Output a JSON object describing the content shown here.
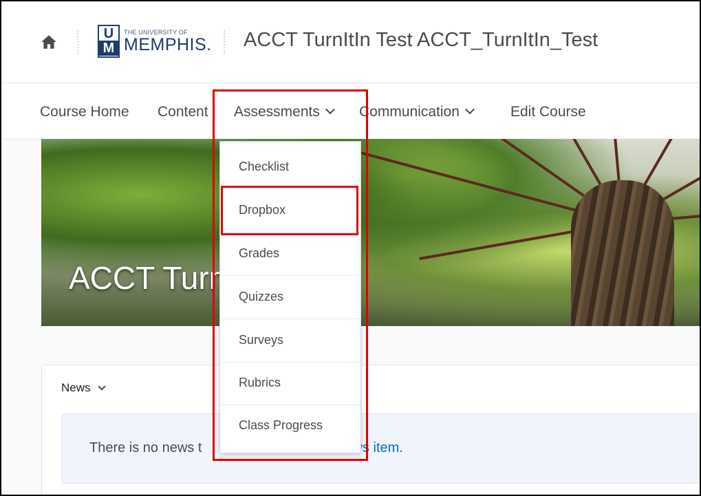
{
  "header": {
    "home_icon": "home-icon",
    "logo": {
      "small_text": "THE UNIVERSITY OF",
      "big_text": "MEMPHIS.",
      "mark_top": "U",
      "mark_bottom": "M"
    },
    "course_title": "ACCT TurnItIn Test ACCT_TurnItIn_Test"
  },
  "nav": {
    "items": [
      {
        "label": "Course Home"
      },
      {
        "label": "Content"
      },
      {
        "label": "Assessments",
        "has_dropdown": true
      },
      {
        "label": "Communication",
        "has_dropdown": true
      },
      {
        "label": "Edit Course"
      }
    ]
  },
  "banner": {
    "title": "ACCT TurnItIn Test"
  },
  "dropdown": {
    "items": [
      {
        "label": "Checklist"
      },
      {
        "label": "Dropbox"
      },
      {
        "label": "Grades"
      },
      {
        "label": "Quizzes"
      },
      {
        "label": "Surveys"
      },
      {
        "label": "Rubrics"
      },
      {
        "label": "Class Progress"
      }
    ]
  },
  "news": {
    "label": "News",
    "empty_text_prefix": "There is no news t",
    "empty_link": "ews item",
    "empty_suffix": "."
  },
  "colors": {
    "highlight": "#e00000",
    "link": "#006fbf",
    "brand": "#1e3a6e"
  }
}
